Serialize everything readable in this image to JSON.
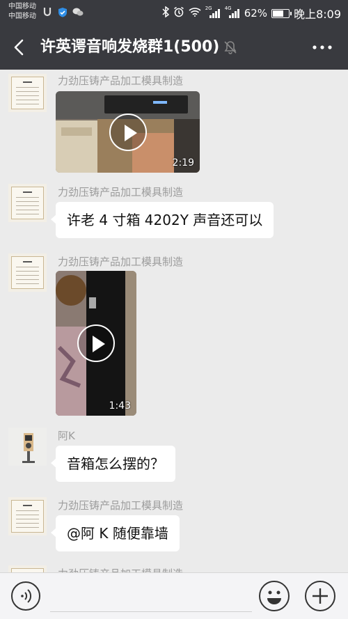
{
  "status_bar": {
    "carrier_1": "中国移动",
    "carrier_2": "中国移动",
    "network_1": "2G",
    "network_2": "4G",
    "battery_percent": "62%",
    "battery_level": 0.62,
    "time": "晚上8:09"
  },
  "header": {
    "title": "许英谔音响发烧群1(500)",
    "back_icon": "back-chevron-icon",
    "mute_icon": "mute-bell-icon",
    "more_icon": "more-dots-icon"
  },
  "messages": [
    {
      "sender": "力劲压铸产品加工模具制造",
      "type": "video",
      "duration": "2:19"
    },
    {
      "sender": "力劲压铸产品加工模具制造",
      "type": "text",
      "text": "许老 4 寸箱 4202Y 声音还可以"
    },
    {
      "sender": "力劲压铸产品加工模具制造",
      "type": "video",
      "duration": "1:43"
    },
    {
      "sender": "阿K",
      "type": "text",
      "text": "音箱怎么摆的？"
    },
    {
      "sender": "力劲压铸产品加工模具制造",
      "type": "text",
      "text": "@阿 K  随便靠墙"
    },
    {
      "sender": "力劲压铸产品加工模具制造",
      "type": "text",
      "text": ""
    }
  ],
  "input_bar": {
    "voice_icon": "voice-icon",
    "emoji_icon": "emoji-icon",
    "plus_icon": "plus-icon"
  },
  "colors": {
    "header_bg": "#393a3f",
    "chat_bg": "#ebebeb",
    "bubble_bg": "#ffffff"
  }
}
